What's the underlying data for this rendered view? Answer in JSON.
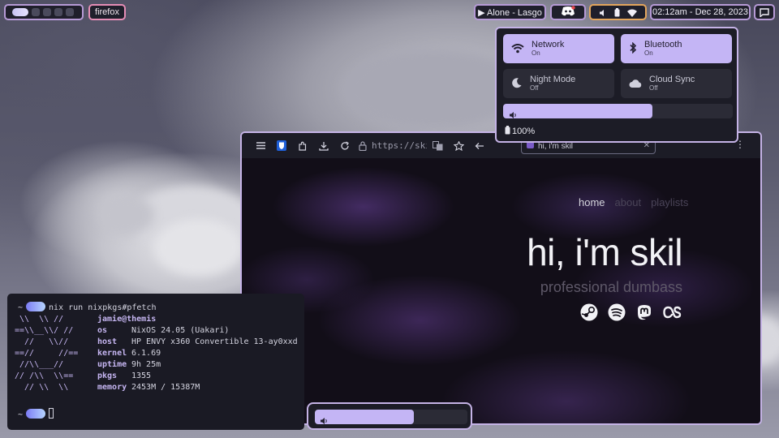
{
  "topbar": {
    "workspaces": {
      "active_index": 0,
      "count": 5
    },
    "window_title": "firefox",
    "media": "▶ Alone - Lasgo",
    "clock": "02:12am - Dec 28, 2023",
    "icons": [
      "discord-icon",
      "volume-icon",
      "battery-icon",
      "wifi-icon",
      "notification-icon"
    ],
    "colors": {
      "accent": "#b69ad6",
      "title_border": "#e58db6",
      "tray_border": "#e3a55c"
    }
  },
  "quick_settings": {
    "tiles": [
      {
        "name": "Network",
        "state": "On",
        "active": true,
        "icon": "wifi-icon"
      },
      {
        "name": "Bluetooth",
        "state": "On",
        "active": true,
        "icon": "bluetooth-icon"
      },
      {
        "name": "Night Mode",
        "state": "Off",
        "active": false,
        "icon": "moon-icon"
      },
      {
        "name": "Cloud Sync",
        "state": "Off",
        "active": false,
        "icon": "cloud-icon"
      }
    ],
    "volume_fraction": 0.65,
    "battery": "100%"
  },
  "browser": {
    "url": "https://skil",
    "tab_title": "hi, i'm skil",
    "page": {
      "nav": [
        "home",
        "about",
        "playlists"
      ],
      "heading": "hi, i'm skil",
      "subheading": "professional dumbass",
      "socials": [
        "steam-icon",
        "spotify-icon",
        "mastodon-icon",
        "lastfm-icon"
      ]
    }
  },
  "terminal": {
    "prompt_symbol": "~",
    "command": "nix run nixpkgs#pfetch",
    "user_host": "jamie@themis",
    "logo": [
      " \\\\  \\\\ //",
      "==\\\\__\\\\/ //",
      "  //   \\\\//",
      "==//     //==",
      " //\\\\___//",
      "// /\\\\  \\\\==",
      "  // \\\\  \\\\"
    ],
    "fields": [
      {
        "key": "os",
        "value": "NixOS 24.05 (Uakari)"
      },
      {
        "key": "host",
        "value": "HP ENVY x360 Convertible 13-ay0xxd"
      },
      {
        "key": "kernel",
        "value": "6.1.69"
      },
      {
        "key": "uptime",
        "value": "9h 25m"
      },
      {
        "key": "pkgs",
        "value": "1355"
      },
      {
        "key": "memory",
        "value": "2453M / 15387M"
      }
    ]
  },
  "osd": {
    "volume_fraction": 0.65
  }
}
